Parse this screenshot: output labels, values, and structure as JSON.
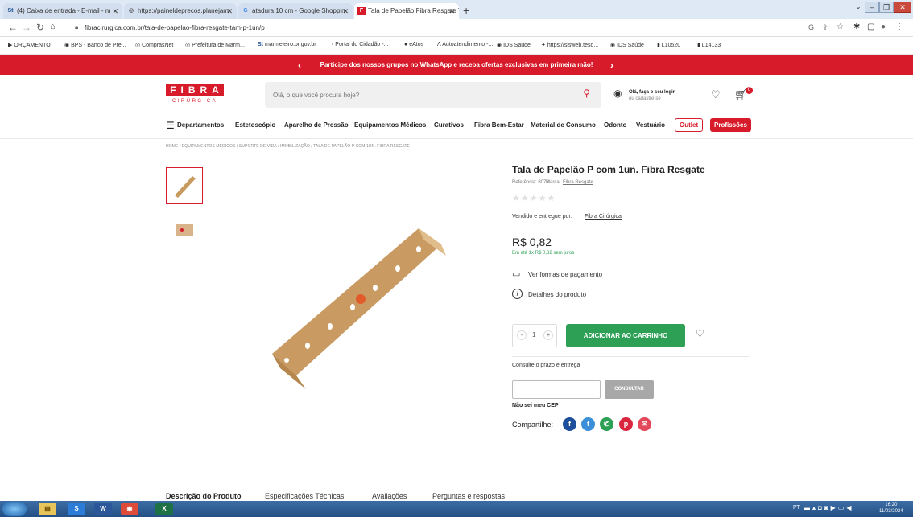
{
  "browser": {
    "tabs": [
      {
        "label": "(4) Caixa de entrada - E-mail - m",
        "favicon": "St"
      },
      {
        "label": "https://paineldeprecos.planejam",
        "favicon": "globe"
      },
      {
        "label": "atadura 10 cm - Google Shoppin",
        "favicon": "G"
      },
      {
        "label": "Tala de Papelão Fibra Resgate Ta",
        "favicon": "F"
      }
    ],
    "url": "fibracirurgica.com.br/tala-de-papelao-fibra-resgate-tam-p-1un/p",
    "bookmarks": [
      "ORÇAMENTO",
      "BPS - Banco de Pre...",
      "ComprasNet",
      "Prefeitura de Marm...",
      "marmeleiro.pr.gov.br",
      "Portal do Cidadão -...",
      "eAtos",
      "Autoatendimento -...",
      "IDS Saúde",
      "https://sisweb.teso...",
      "IDS Saúde",
      "L10520",
      "L14133"
    ]
  },
  "promo": {
    "text": "Participe dos nossos grupos no WhatsApp e receba ofertas exclusivas em primeira mão!"
  },
  "header": {
    "logo_top": "FIBRA",
    "logo_bottom": "CIRÚRGICA",
    "search_placeholder": "Olá, o que você procura hoje?",
    "login_line1": "Olá, faça o seu login",
    "login_line2": "ou cadastre-se",
    "cart_count": "0"
  },
  "nav": {
    "departments": "Departamentos",
    "items": [
      "Estetoscópio",
      "Aparelho de Pressão",
      "Equipamentos Médicos",
      "Curativos",
      "Fibra Bem-Estar",
      "Material de Consumo",
      "Odonto",
      "Vestuário"
    ],
    "outlet": "Outlet",
    "profissoes": "Profissões"
  },
  "breadcrumb": "HOME  /  EQUIPAMENTOS MÉDICOS  /  SUPORTE DE VIDA  /  IMOBILIZAÇÃO  /  TALA DE PAPELÃO P COM 1UN. FIBRA RESGATE",
  "product": {
    "title": "Tala de Papelão P com 1un. Fibra Resgate",
    "reference_label": "Referência: 8078",
    "brand_label": "Marca:",
    "brand": "Fibra Resgate",
    "seller_label": "Vendido e entregue por:",
    "seller": "Fibra Cirúrgica",
    "price": "R$ 0,82",
    "installments": "Em até 1x R$ 0,82 sem juros",
    "payment_link": "Ver formas de pagamento",
    "details_link": "Detalhes do produto",
    "quantity": "1",
    "add_to_cart": "ADICIONAR AO CARRINHO",
    "shipping_label": "Consulte o prazo e entrega",
    "consult_button": "CONSULTAR",
    "no_cep": "Não sei meu CEP",
    "share_label": "Compartilhe:"
  },
  "bottom_tabs": [
    "Descrição do Produto",
    "Especificações Técnicas",
    "Avaliações",
    "Perguntas e respostas"
  ],
  "taskbar": {
    "lang": "PT",
    "time": "16:20",
    "date": "11/03/2024"
  },
  "colors": {
    "brand_red": "#d71b2a",
    "green": "#2ea056"
  }
}
